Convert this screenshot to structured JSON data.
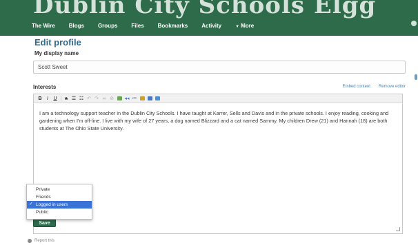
{
  "header": {
    "site_title": "Dublin City Schools Elgg",
    "nav": [
      {
        "label": "The Wire"
      },
      {
        "label": "Blogs"
      },
      {
        "label": "Groups"
      },
      {
        "label": "Files"
      },
      {
        "label": "Bookmarks"
      },
      {
        "label": "Activity"
      },
      {
        "label": "More"
      }
    ]
  },
  "profile": {
    "title": "Edit profile",
    "display_name_label": "My display name",
    "display_name_value": "Scott Sweet",
    "interests_label": "Interests",
    "editor_links": {
      "embed": "Embed content",
      "remove": "Remove editor"
    },
    "toolbar_icons": [
      "bold-icon",
      "italic-icon",
      "underline-icon",
      "strikethrough-icon",
      "bullet-list-icon",
      "numbered-list-icon",
      "undo-icon",
      "redo-icon",
      "link-icon",
      "unlink-icon",
      "image-icon",
      "blockquote-icon",
      "paste-icon",
      "paste-text-icon",
      "paste-word-icon",
      "code-icon"
    ],
    "interests_text": "I am a technology support teacher in the Dublin City Schools. I have taught at Karrer, Sells and Davis and in the private schools. I enjoy reading, cooking and gardening when I'm off-line. I live with my wife of 27 years, a dog named Blizzard and a cat named Sammy. My children Drew (21) and Hannah (18) are both students at The Ohio State University.",
    "access_options": [
      {
        "label": "Private",
        "selected": false
      },
      {
        "label": "Friends",
        "selected": false
      },
      {
        "label": "Logged in users",
        "selected": true
      },
      {
        "label": "Public",
        "selected": false
      }
    ],
    "save_label": "Save",
    "report_label": "Report this"
  },
  "colors": {
    "header_bg": "#2e6b4a",
    "accent_blue": "#2d6a8e",
    "selected_option": "#3a73d8",
    "save_button": "#2c6b4b"
  }
}
